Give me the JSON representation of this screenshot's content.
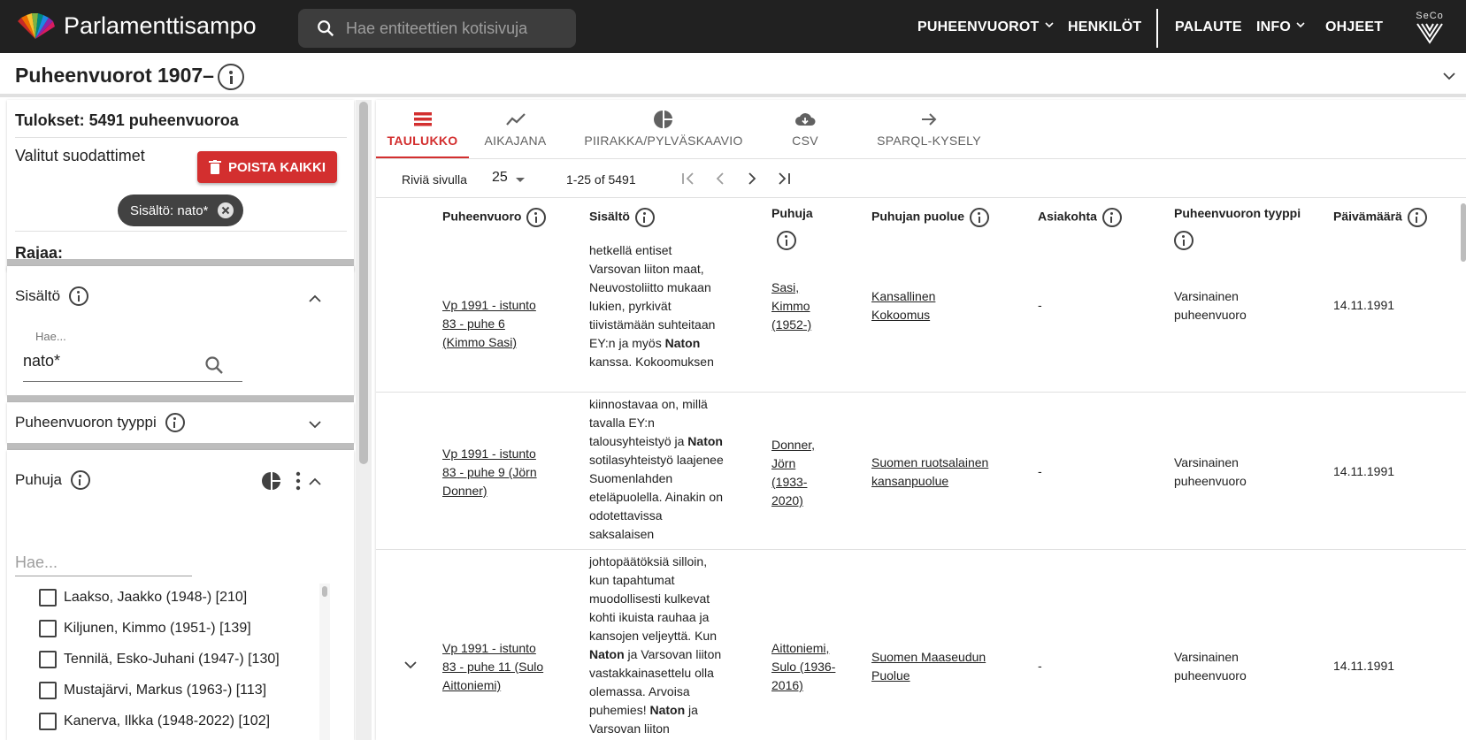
{
  "appbar": {
    "title": "Parlamenttisampo",
    "search_placeholder": "Hae entiteettien kotisivuja",
    "nav": {
      "puheenvuorot": "PUHEENVUOROT",
      "henkilot": "HENKILÖT",
      "palaute": "PALAUTE",
      "info": "INFO",
      "ohjeet": "OHJEET"
    },
    "seco_logo_text": "SeCo"
  },
  "page": {
    "title": "Puheenvuorot 1907–"
  },
  "sidebar": {
    "results": "Tulokset: 5491 puheenvuoroa",
    "selected_filters": "Valitut suodattimet",
    "remove_all": "POISTA KAIKKI",
    "chip": "Sisältö: nato*",
    "rajaa": "Rajaa:",
    "facets": {
      "sisalto": {
        "title": "Sisältö",
        "search_label": "Hae...",
        "search_value": "nato*"
      },
      "tyyppi": {
        "title": "Puheenvuoron tyyppi"
      },
      "puhuja": {
        "title": "Puhuja",
        "search_placeholder": "Hae...",
        "items": [
          {
            "label": "Laakso, Jaakko (1948-) [210]"
          },
          {
            "label": "Kiljunen, Kimmo (1951-) [139]"
          },
          {
            "label": "Tennilä, Esko-Juhani (1947-) [130]"
          },
          {
            "label": "Mustajärvi, Markus (1963-) [113]"
          },
          {
            "label": "Kanerva, Ilkka (1948-2022) [102]"
          }
        ]
      }
    }
  },
  "main": {
    "tabs": [
      {
        "label": "TAULUKKO",
        "icon": "table-icon"
      },
      {
        "label": "AIKAJANA",
        "icon": "timeline-icon"
      },
      {
        "label": "PIIRAKKA/PYLVÄSKAAVIO",
        "icon": "pie-chart-icon"
      },
      {
        "label": "CSV",
        "icon": "cloud-download-icon"
      },
      {
        "label": "SPARQL-KYSELY",
        "icon": "arrow-right-icon"
      }
    ],
    "pagination": {
      "rows_label": "Riviä sivulla",
      "rows_value": "25",
      "range": "1-25 of 5491"
    },
    "columns": {
      "puheenvuoro": "Puheenvuoro",
      "sisalto": "Sisältö",
      "puhuja": "Puhuja",
      "puolue": "Puhujan puolue",
      "asiakohta": "Asiakohta",
      "tyyppi": "Puheenvuoron tyyppi",
      "paivamaara": "Päivämäärä"
    },
    "rows": [
      {
        "speech_l1": "Vp 1991 - istunto",
        "speech_l2": "83 - puhe 6",
        "speech_l3": "(Kimmo Sasi)",
        "content": [
          "hetkellä entiset",
          "Varsovan liiton maat,",
          "Neuvostoliitto mukaan",
          "lukien, pyrkivät",
          "tiivistämään suhteitaan",
          "EY:n ja myös ",
          "Naton",
          "kanssa. Kokoomuksen"
        ],
        "speaker_l1": "Sasi,",
        "speaker_l2": "Kimmo",
        "speaker_l3": "(1952-)",
        "party_l1": "Kansallinen",
        "party_l2": "Kokoomus",
        "item": "-",
        "type_l1": "Varsinainen",
        "type_l2": "puheenvuoro",
        "date": "14.11.1991"
      },
      {
        "speech_l1": "Vp 1991 - istunto",
        "speech_l2": "83 - puhe 9 (Jörn",
        "speech_l3": "Donner)",
        "content": [
          "kiinnostavaa on, millä",
          "tavalla EY:n",
          "talousyhteistyö ja ",
          "Naton",
          "sotilasyhteistyö laajenee",
          "Suomenlahden",
          "eteläpuolella. Ainakin on",
          "odotettavissa",
          "saksalaisen"
        ],
        "speaker_l1": "Donner,",
        "speaker_l2": "Jörn",
        "speaker_l3": "(1933-",
        "speaker_l4": "2020)",
        "party_l1": "Suomen ruotsalainen",
        "party_l2": "kansanpuolue",
        "item": "-",
        "type_l1": "Varsinainen",
        "type_l2": "puheenvuoro",
        "date": "14.11.1991"
      },
      {
        "speech_l1": "Vp 1991 - istunto",
        "speech_l2": "83 - puhe 11 (Sulo",
        "speech_l3": "Aittoniemi)",
        "content": [
          "johtopäätöksiä silloin,",
          "kun tapahtumat",
          "muodollisesti kulkevat",
          "kohti ikuista rauhaa ja",
          "kansojen veljeyttä. Kun",
          "Naton",
          " ja Varsovan liiton",
          "vastakkainasettelu olla",
          "olemassa. Arvoisa",
          "puhemies! ",
          "Naton",
          " ja",
          "Varsovan liiton"
        ],
        "speaker_l1": "Aittoniemi,",
        "speaker_l2": "Sulo (1936-",
        "speaker_l3": "2016)",
        "party_l1": "Suomen Maaseudun",
        "party_l2": "Puolue",
        "item": "-",
        "type_l1": "Varsinainen",
        "type_l2": "puheenvuoro",
        "date": "14.11.1991"
      }
    ]
  },
  "colors": {
    "appbar": "#212121",
    "accent": "#d32f2f"
  }
}
